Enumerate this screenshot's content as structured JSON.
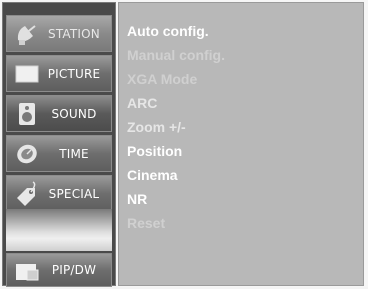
{
  "sidebar": {
    "items": [
      {
        "label": "STATION",
        "icon": "satellite-dish-icon"
      },
      {
        "label": "PICTURE",
        "icon": "picture-icon"
      },
      {
        "label": "SOUND",
        "icon": "speaker-icon"
      },
      {
        "label": "TIME",
        "icon": "clock-icon"
      },
      {
        "label": "SPECIAL",
        "icon": "tag-icon"
      },
      {
        "label": "PIP/DW",
        "icon": "pip-icon"
      }
    ]
  },
  "menu": {
    "options": [
      "Auto config.",
      "Manual config.",
      "XGA Mode",
      "ARC",
      "Zoom +/-",
      "Position",
      "Cinema",
      "NR",
      "Reset"
    ]
  }
}
